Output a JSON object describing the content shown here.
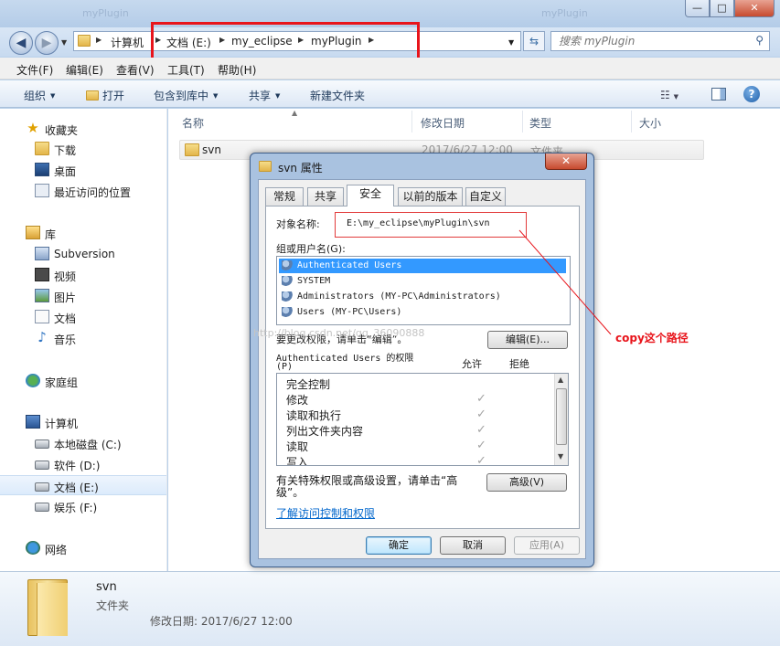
{
  "window": {
    "ghost_tab_1": "myPlugin",
    "ghost_tab_2": "myPlugin",
    "min": "—",
    "max": "□",
    "close": "✕"
  },
  "nav": {
    "back": "◀",
    "forward": "▶",
    "crumbs": [
      "计算机",
      "文档 (E:)",
      "my_eclipse",
      "myPlugin"
    ],
    "search_placeholder": "搜索 myPlugin"
  },
  "menu": [
    "文件(F)",
    "编辑(E)",
    "查看(V)",
    "工具(T)",
    "帮助(H)"
  ],
  "toolbar": {
    "organize": "组织",
    "open": "打开",
    "include_library": "包含到库中",
    "share": "共享",
    "new_folder": "新建文件夹",
    "help": "?"
  },
  "sidebar": {
    "favorites": "收藏夹",
    "downloads": "下载",
    "desktop": "桌面",
    "recent": "最近访问的位置",
    "libraries": "库",
    "subversion": "Subversion",
    "videos": "视频",
    "pictures": "图片",
    "documents": "文档",
    "music": "音乐",
    "homegroup": "家庭组",
    "computer": "计算机",
    "drive_c": "本地磁盘 (C:)",
    "drive_d": "软件 (D:)",
    "drive_e": "文档 (E:)",
    "drive_f": "娱乐 (F:)",
    "network": "网络"
  },
  "columns": {
    "name": "名称",
    "modified": "修改日期",
    "type": "类型",
    "size": "大小"
  },
  "file": {
    "name": "svn",
    "modified": "2017/6/27 12:00",
    "type": "文件夹"
  },
  "status": {
    "name": "svn",
    "type": "文件夹",
    "modified": "修改日期: 2017/6/27 12:00"
  },
  "dialog": {
    "title": "svn 属性",
    "close": "✕",
    "tabs": [
      "常规",
      "共享",
      "安全",
      "以前的版本",
      "自定义"
    ],
    "object_label": "对象名称:",
    "object_path": "E:\\my_eclipse\\myPlugin\\svn",
    "group_label": "组或用户名(G):",
    "users": [
      "Authenticated Users",
      "SYSTEM",
      "Administrators (MY-PC\\Administrators)",
      "Users (MY-PC\\Users)"
    ],
    "change_hint": "要更改权限，请单击“编辑”。",
    "edit_button": "编辑(E)...",
    "perm_title": "Authenticated Users 的权限",
    "perm_p": "(P)",
    "allow": "允许",
    "deny": "拒绝",
    "permissions": [
      "完全控制",
      "修改",
      "读取和执行",
      "列出文件夹内容",
      "读取",
      "写入"
    ],
    "allowed": [
      false,
      true,
      true,
      true,
      true,
      true
    ],
    "advanced_hint_1": "有关特殊权限或高级设置，请单击“高",
    "advanced_hint_2": "级”。",
    "advanced_button": "高级(V)",
    "learn_link": "了解访问控制和权限",
    "ok": "确定",
    "cancel": "取消",
    "apply": "应用(A)"
  },
  "annotation": {
    "text": "copy这个路径",
    "color": "#e8141b"
  },
  "watermark": "http://blog.csdn.net/qq_36090888"
}
